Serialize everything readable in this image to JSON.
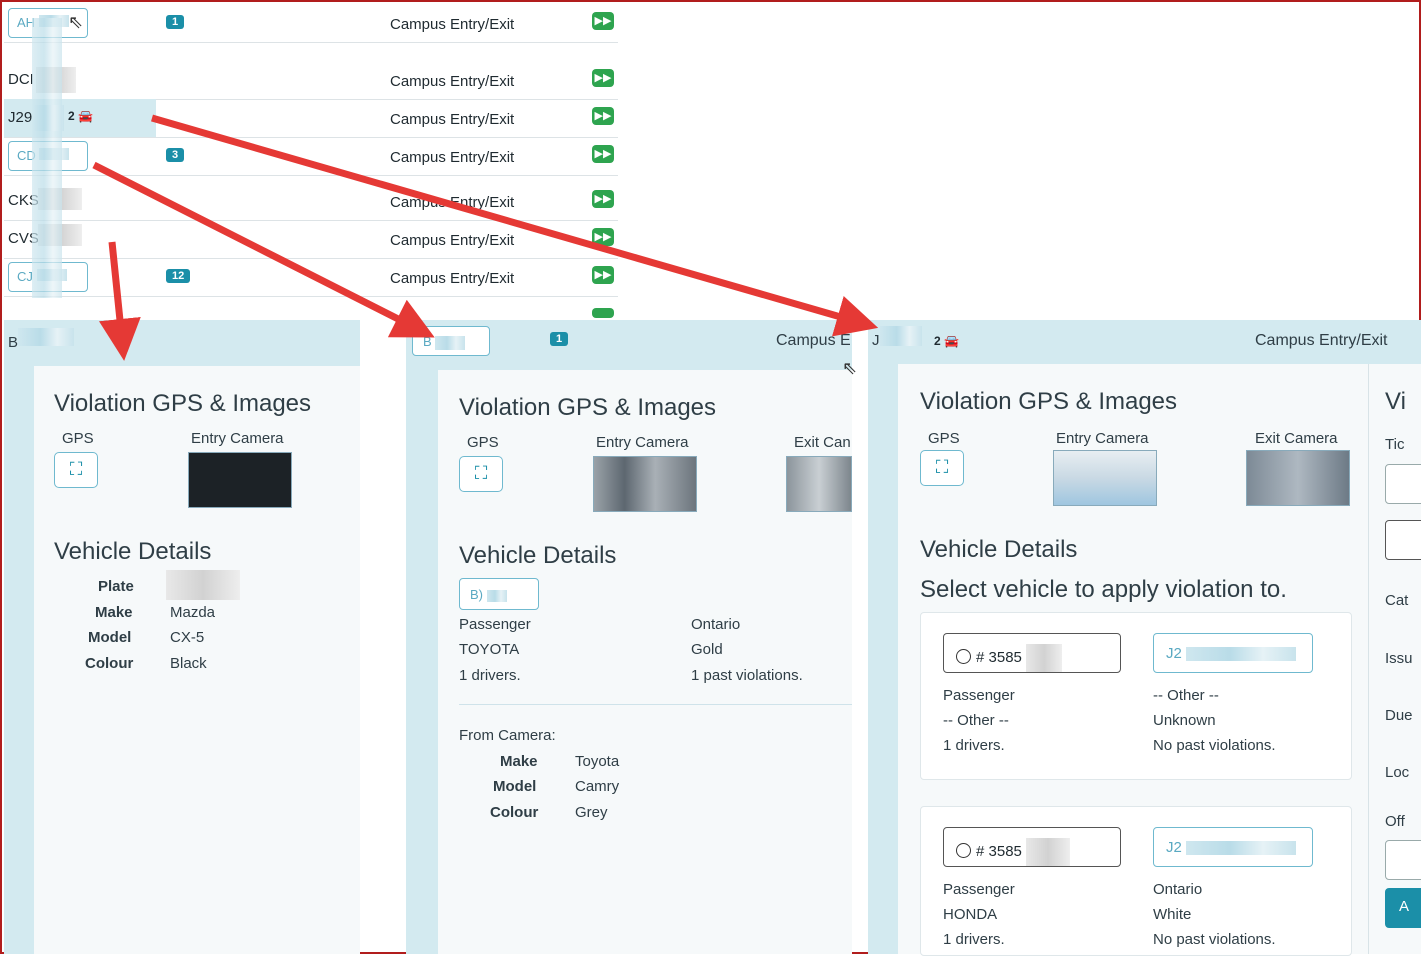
{
  "list": {
    "rows": [
      {
        "code": "AH",
        "badge": "1",
        "location": "Campus Entry/Exit"
      },
      {
        "code": "DCI",
        "badge": "",
        "location": "Campus Entry/Exit"
      },
      {
        "code": "J29",
        "cars": "2",
        "location": "Campus Entry/Exit"
      },
      {
        "code": "CD",
        "badge": "3",
        "location": "Campus Entry/Exit"
      },
      {
        "code": "CKS",
        "badge": "",
        "location": "Campus Entry/Exit"
      },
      {
        "code": "CVS",
        "badge": "",
        "location": "Campus Entry/Exit"
      },
      {
        "code": "CJ",
        "badge": "12",
        "location": "Campus Entry/Exit"
      }
    ]
  },
  "panel1": {
    "code": "B",
    "gps_heading": "Violation GPS & Images",
    "gps_label": "GPS",
    "entry_label": "Entry Camera",
    "vehicle_heading": "Vehicle Details",
    "plate_label": "Plate",
    "make_label": "Make",
    "make": "Mazda",
    "model_label": "Model",
    "model": "CX-5",
    "colour_label": "Colour",
    "colour": "Black"
  },
  "panel2": {
    "plate_prefix": "B",
    "badge": "1",
    "location": "Campus E",
    "gps_heading": "Violation GPS & Images",
    "gps_label": "GPS",
    "entry_label": "Entry Camera",
    "exit_label": "Exit Can",
    "vehicle_heading": "Vehicle Details",
    "vehicle_plate": "B)",
    "type": "Passenger",
    "province": "Ontario",
    "make": "TOYOTA",
    "color": "Gold",
    "drivers": "1 drivers.",
    "violations": "1 past violations.",
    "from_camera": "From Camera:",
    "make_label": "Make",
    "cam_make": "Toyota",
    "model_label": "Model",
    "cam_model": "Camry",
    "colour_label": "Colour",
    "cam_colour": "Grey"
  },
  "panel3": {
    "code": "J",
    "cars": "2",
    "location": "Campus Entry/Exit",
    "gps_heading": "Violation GPS & Images",
    "gps_label": "GPS",
    "entry_label": "Entry Camera",
    "exit_label": "Exit Camera",
    "vehicle_heading": "Vehicle Details",
    "select_text": "Select vehicle to apply violation to.",
    "vehicles": [
      {
        "radio": "# 3585",
        "plate": "J2",
        "type": "Passenger",
        "province": "-- Other --",
        "make": "-- Other --",
        "color": "Unknown",
        "drivers": "1 drivers.",
        "violations": "No past violations."
      },
      {
        "radio": "# 3585",
        "plate": "J2",
        "type": "Passenger",
        "province": "Ontario",
        "make": "HONDA",
        "color": "White",
        "drivers": "1 drivers.",
        "violations": "No past violations."
      }
    ]
  },
  "panel4": {
    "heading": "Vi",
    "labels": [
      "Tic",
      "Cat",
      "Issu",
      "Due",
      "Loc",
      "Off"
    ],
    "button": "A"
  },
  "colors": {
    "accent": "#1b8fa8",
    "panel_bg": "#d3eaf0",
    "arrow": "#e53935",
    "go": "#2ea44f"
  }
}
